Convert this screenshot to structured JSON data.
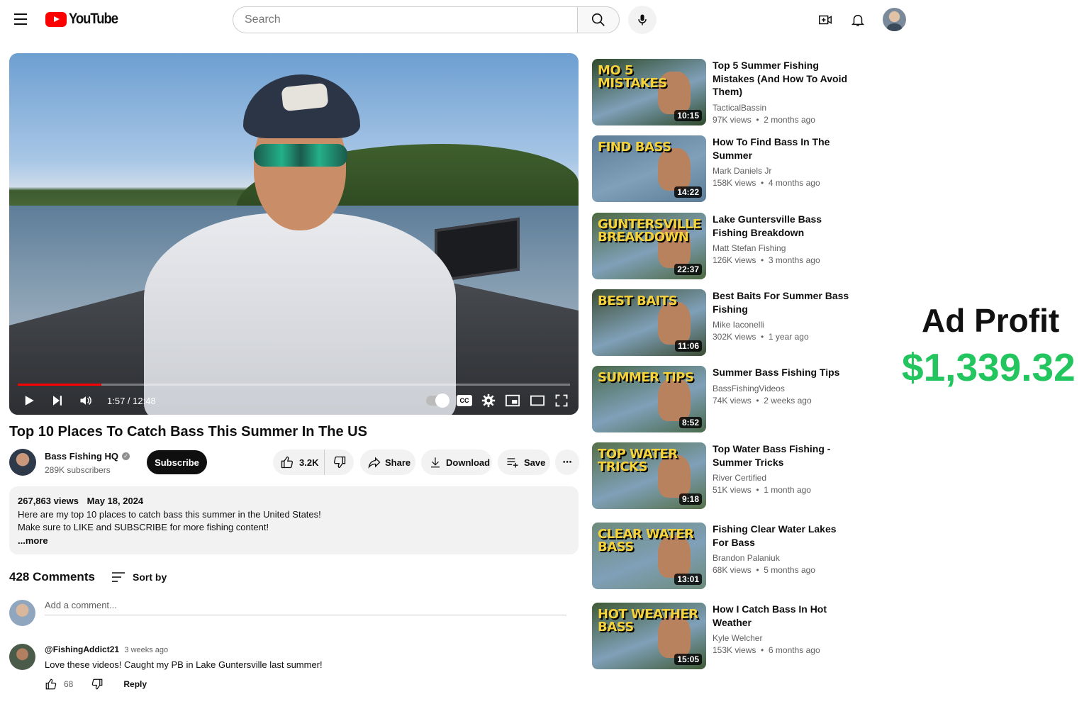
{
  "header": {
    "logo_text": "YouTube",
    "search_placeholder": "Search"
  },
  "player": {
    "time": "1:57 / 12:48",
    "progress": 0.152,
    "cc_label": "CC"
  },
  "video": {
    "title": "Top 10 Places To Catch Bass This Summer In The US",
    "channel_name": "Bass Fishing HQ",
    "subscribers": "289K subscribers",
    "subscribe_label": "Subscribe",
    "likes": "3.2K",
    "share_label": "Share",
    "download_label": "Download",
    "save_label": "Save",
    "more_label": "⋯"
  },
  "description": {
    "views": "267,863 views",
    "date": "May 18, 2024",
    "line1": "Here are my top 10 places to catch bass this summer in the United States!",
    "line2": "Make sure to LIKE and SUBSCRIBE for more fishing content!",
    "more": "...more"
  },
  "comments": {
    "count_label": "428 Comments",
    "sort_label": "Sort by",
    "add_placeholder": "Add a comment...",
    "items": [
      {
        "author": "@FishingAddict21",
        "time": "3 weeks ago",
        "text": "Love these videos! Caught my PB in Lake Guntersville last summer!",
        "likes": "68",
        "reply_label": "Reply"
      }
    ]
  },
  "recommendations": [
    {
      "title": "Top 5 Summer Fishing Mistakes (And How To Avoid Them)",
      "channel": "TacticalBassin",
      "views": "97K views",
      "age": "2 months ago",
      "duration": "10:15",
      "thumb_text": "MO 5 MISTAKES",
      "thumb_bg": "#2f4a2a"
    },
    {
      "title": "How To Find Bass In The Summer",
      "channel": "Mark Daniels Jr",
      "views": "158K views",
      "age": "4 months ago",
      "duration": "14:22",
      "thumb_text": "FIND BASS",
      "thumb_bg": "#5d7d98"
    },
    {
      "title": "Lake Guntersville Bass Fishing Breakdown",
      "channel": "Matt Stefan Fishing",
      "views": "126K views",
      "age": "3 months ago",
      "duration": "22:37",
      "thumb_text": "GUNTERSVILLE BREAKDOWN",
      "thumb_bg": "#4d6840"
    },
    {
      "title": "Best Baits For Summer Bass Fishing",
      "channel": "Mike Iaconelli",
      "views": "302K views",
      "age": "1 year ago",
      "duration": "11:06",
      "thumb_text": "BEST BAITS",
      "thumb_bg": "#3c4c33"
    },
    {
      "title": "Summer Bass Fishing Tips",
      "channel": "BassFishingVideos",
      "views": "74K views",
      "age": "2 weeks ago",
      "duration": "8:52",
      "thumb_text": "SUMMER TIPS",
      "thumb_bg": "#4a6a4c"
    },
    {
      "title": "Top Water Bass Fishing - Summer Tricks",
      "channel": "River Certified",
      "views": "51K views",
      "age": "1 month ago",
      "duration": "9:18",
      "thumb_text": "TOP WATER TRICKS",
      "thumb_bg": "#557048"
    },
    {
      "title": "Fishing Clear Water Lakes For Bass",
      "channel": "Brandon Palaniuk",
      "views": "68K views",
      "age": "5 months ago",
      "duration": "13:01",
      "thumb_text": "CLEAR WATER BASS",
      "thumb_bg": "#6d8a7a"
    },
    {
      "title": "How I Catch Bass In Hot Weather",
      "channel": "Kyle Welcher",
      "views": "153K views",
      "age": "6 months ago",
      "duration": "15:05",
      "thumb_text": "HOT WEATHER BASS",
      "thumb_bg": "#3f5a35"
    }
  ],
  "overlay": {
    "label": "Ad Profit",
    "value": "$1,339.32",
    "value_color": "#22c55e"
  }
}
